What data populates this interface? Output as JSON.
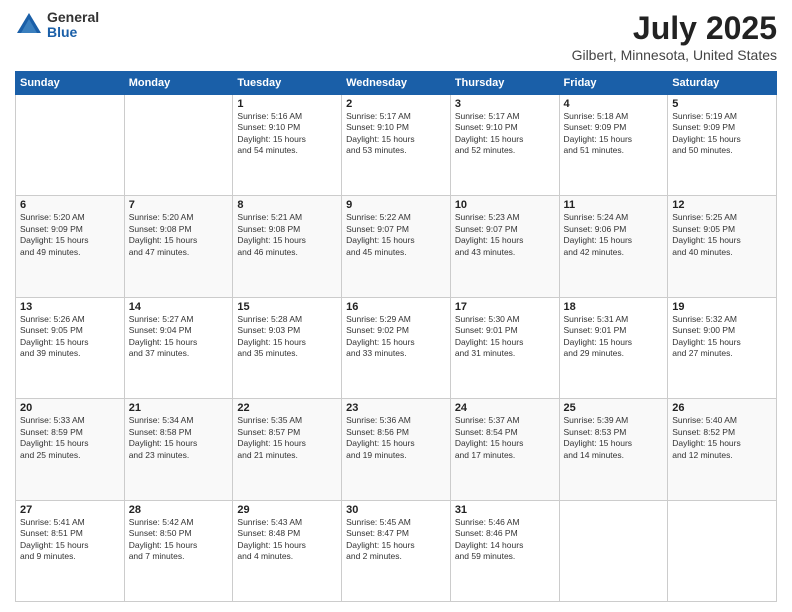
{
  "logo": {
    "general": "General",
    "blue": "Blue"
  },
  "title": "July 2025",
  "subtitle": "Gilbert, Minnesota, United States",
  "weekdays": [
    "Sunday",
    "Monday",
    "Tuesday",
    "Wednesday",
    "Thursday",
    "Friday",
    "Saturday"
  ],
  "weeks": [
    [
      {
        "day": "",
        "info": ""
      },
      {
        "day": "",
        "info": ""
      },
      {
        "day": "1",
        "info": "Sunrise: 5:16 AM\nSunset: 9:10 PM\nDaylight: 15 hours\nand 54 minutes."
      },
      {
        "day": "2",
        "info": "Sunrise: 5:17 AM\nSunset: 9:10 PM\nDaylight: 15 hours\nand 53 minutes."
      },
      {
        "day": "3",
        "info": "Sunrise: 5:17 AM\nSunset: 9:10 PM\nDaylight: 15 hours\nand 52 minutes."
      },
      {
        "day": "4",
        "info": "Sunrise: 5:18 AM\nSunset: 9:09 PM\nDaylight: 15 hours\nand 51 minutes."
      },
      {
        "day": "5",
        "info": "Sunrise: 5:19 AM\nSunset: 9:09 PM\nDaylight: 15 hours\nand 50 minutes."
      }
    ],
    [
      {
        "day": "6",
        "info": "Sunrise: 5:20 AM\nSunset: 9:09 PM\nDaylight: 15 hours\nand 49 minutes."
      },
      {
        "day": "7",
        "info": "Sunrise: 5:20 AM\nSunset: 9:08 PM\nDaylight: 15 hours\nand 47 minutes."
      },
      {
        "day": "8",
        "info": "Sunrise: 5:21 AM\nSunset: 9:08 PM\nDaylight: 15 hours\nand 46 minutes."
      },
      {
        "day": "9",
        "info": "Sunrise: 5:22 AM\nSunset: 9:07 PM\nDaylight: 15 hours\nand 45 minutes."
      },
      {
        "day": "10",
        "info": "Sunrise: 5:23 AM\nSunset: 9:07 PM\nDaylight: 15 hours\nand 43 minutes."
      },
      {
        "day": "11",
        "info": "Sunrise: 5:24 AM\nSunset: 9:06 PM\nDaylight: 15 hours\nand 42 minutes."
      },
      {
        "day": "12",
        "info": "Sunrise: 5:25 AM\nSunset: 9:05 PM\nDaylight: 15 hours\nand 40 minutes."
      }
    ],
    [
      {
        "day": "13",
        "info": "Sunrise: 5:26 AM\nSunset: 9:05 PM\nDaylight: 15 hours\nand 39 minutes."
      },
      {
        "day": "14",
        "info": "Sunrise: 5:27 AM\nSunset: 9:04 PM\nDaylight: 15 hours\nand 37 minutes."
      },
      {
        "day": "15",
        "info": "Sunrise: 5:28 AM\nSunset: 9:03 PM\nDaylight: 15 hours\nand 35 minutes."
      },
      {
        "day": "16",
        "info": "Sunrise: 5:29 AM\nSunset: 9:02 PM\nDaylight: 15 hours\nand 33 minutes."
      },
      {
        "day": "17",
        "info": "Sunrise: 5:30 AM\nSunset: 9:01 PM\nDaylight: 15 hours\nand 31 minutes."
      },
      {
        "day": "18",
        "info": "Sunrise: 5:31 AM\nSunset: 9:01 PM\nDaylight: 15 hours\nand 29 minutes."
      },
      {
        "day": "19",
        "info": "Sunrise: 5:32 AM\nSunset: 9:00 PM\nDaylight: 15 hours\nand 27 minutes."
      }
    ],
    [
      {
        "day": "20",
        "info": "Sunrise: 5:33 AM\nSunset: 8:59 PM\nDaylight: 15 hours\nand 25 minutes."
      },
      {
        "day": "21",
        "info": "Sunrise: 5:34 AM\nSunset: 8:58 PM\nDaylight: 15 hours\nand 23 minutes."
      },
      {
        "day": "22",
        "info": "Sunrise: 5:35 AM\nSunset: 8:57 PM\nDaylight: 15 hours\nand 21 minutes."
      },
      {
        "day": "23",
        "info": "Sunrise: 5:36 AM\nSunset: 8:56 PM\nDaylight: 15 hours\nand 19 minutes."
      },
      {
        "day": "24",
        "info": "Sunrise: 5:37 AM\nSunset: 8:54 PM\nDaylight: 15 hours\nand 17 minutes."
      },
      {
        "day": "25",
        "info": "Sunrise: 5:39 AM\nSunset: 8:53 PM\nDaylight: 15 hours\nand 14 minutes."
      },
      {
        "day": "26",
        "info": "Sunrise: 5:40 AM\nSunset: 8:52 PM\nDaylight: 15 hours\nand 12 minutes."
      }
    ],
    [
      {
        "day": "27",
        "info": "Sunrise: 5:41 AM\nSunset: 8:51 PM\nDaylight: 15 hours\nand 9 minutes."
      },
      {
        "day": "28",
        "info": "Sunrise: 5:42 AM\nSunset: 8:50 PM\nDaylight: 15 hours\nand 7 minutes."
      },
      {
        "day": "29",
        "info": "Sunrise: 5:43 AM\nSunset: 8:48 PM\nDaylight: 15 hours\nand 4 minutes."
      },
      {
        "day": "30",
        "info": "Sunrise: 5:45 AM\nSunset: 8:47 PM\nDaylight: 15 hours\nand 2 minutes."
      },
      {
        "day": "31",
        "info": "Sunrise: 5:46 AM\nSunset: 8:46 PM\nDaylight: 14 hours\nand 59 minutes."
      },
      {
        "day": "",
        "info": ""
      },
      {
        "day": "",
        "info": ""
      }
    ]
  ]
}
